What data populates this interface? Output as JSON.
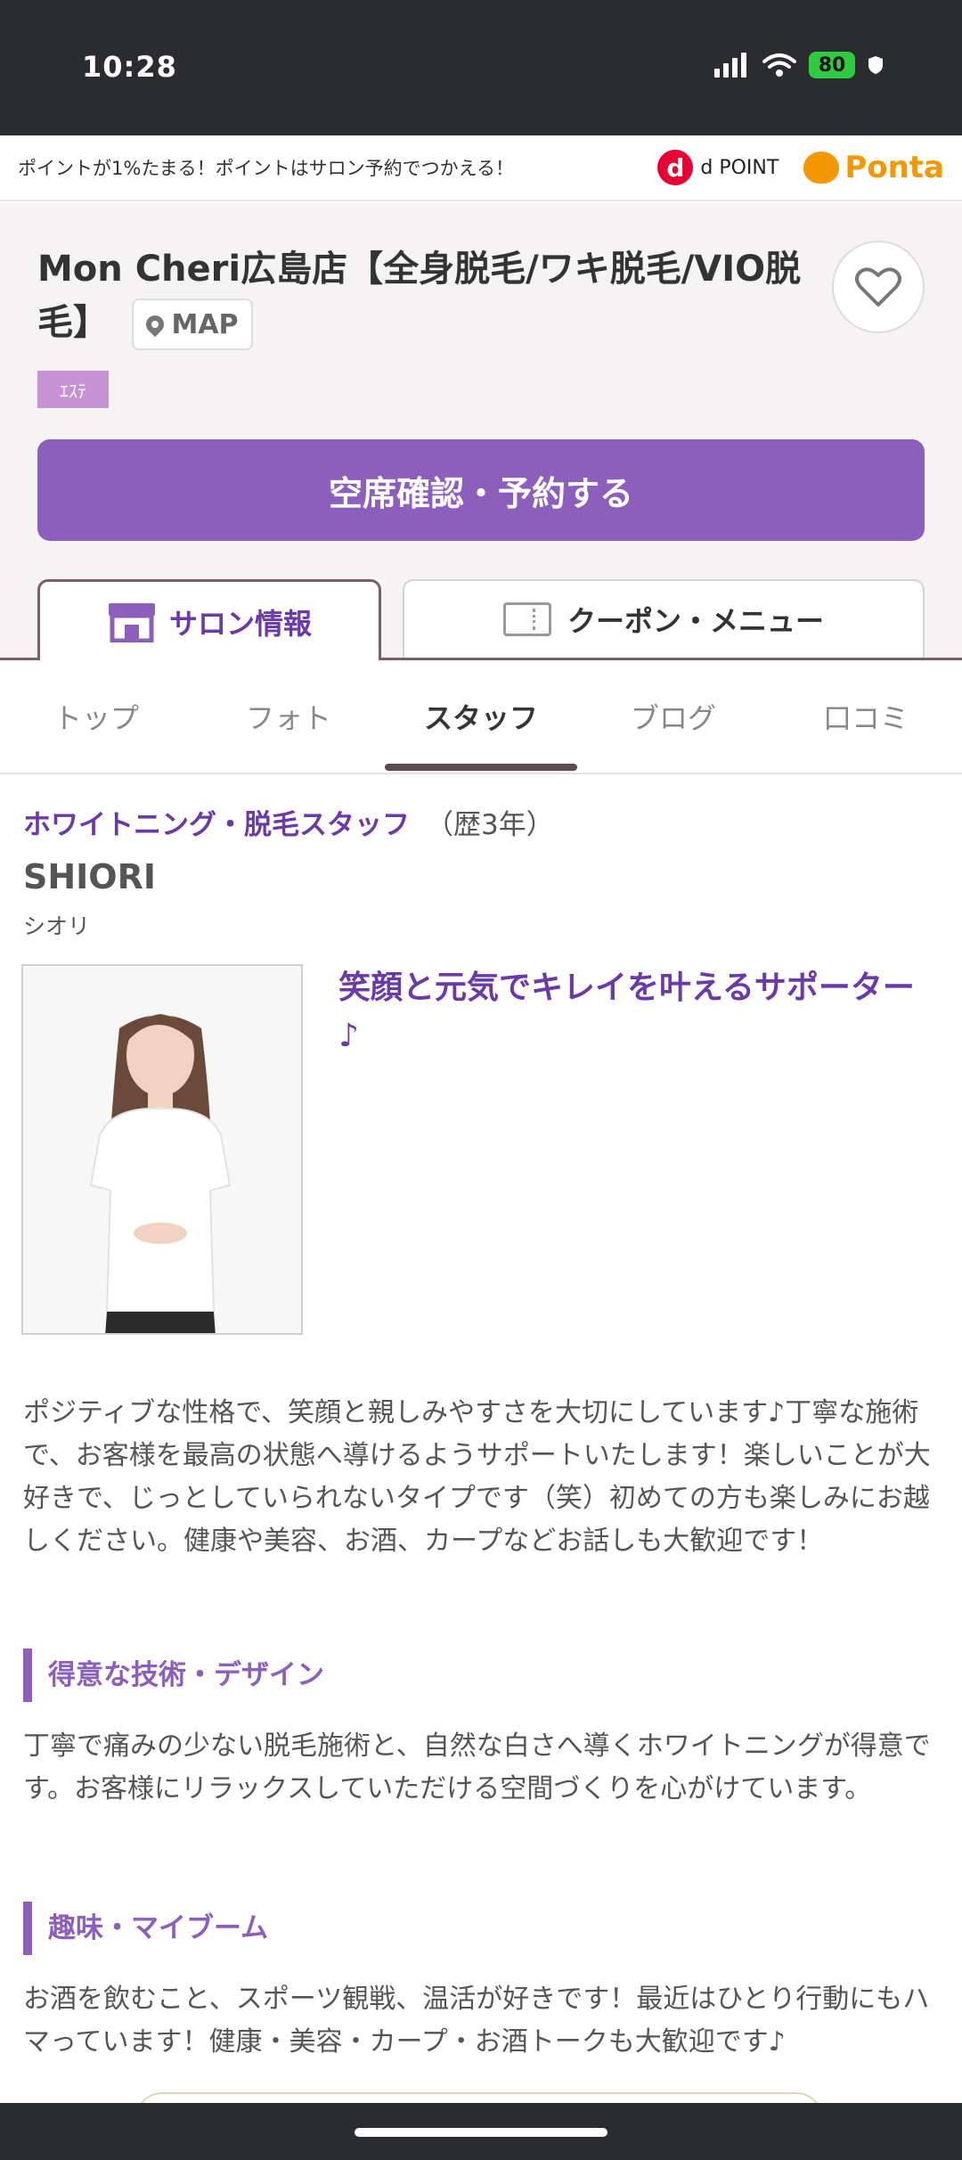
{
  "status_bar": {
    "time": "10:28",
    "battery": "80"
  },
  "points_banner": {
    "text": "ポイントが1%たまる！ポイントはサロン予約でつかえる！",
    "dpoint_mark": "d",
    "dpoint_label": "d POINT",
    "ponta_label": "Ponta"
  },
  "salon": {
    "name": "Mon Cheri広島店【全身脱毛/ワキ脱毛/VIO脱毛】",
    "map_label": "MAP",
    "category": "ｴｽﾃ",
    "reserve_label": "空席確認・予約する"
  },
  "tabs": {
    "salon_info": "サロン情報",
    "coupon_menu": "クーポン・メニュー"
  },
  "subnav": {
    "items": [
      "トップ",
      "フォト",
      "スタッフ",
      "ブログ",
      "口コミ"
    ],
    "active": "スタッフ"
  },
  "staff": {
    "role": "ホワイトニング・脱毛スタッフ",
    "years": "（歴3年）",
    "name": "SHIORI",
    "kana": "シオリ",
    "catchcopy": "笑顔と元気でキレイを叶えるサポーター♪",
    "intro": "ポジティブな性格で、笑顔と親しみやすさを大切にしています♪丁寧な施術で、お客様を最高の状態へ導けるようサポートいたします！楽しいことが大好きで、じっとしていられないタイプです（笑）初めての方も楽しみにお越しください。健康や美容、お酒、カープなどお話しも大歓迎です！",
    "skills_heading": "得意な技術・デザイン",
    "skills_body": "丁寧で痛みの少ない脱毛施術と、自然な白さへ導くホワイトニングが得意です。お客様にリラックスしていただける空間づくりを心がけています。",
    "hobby_heading": "趣味・マイブーム",
    "hobby_body": "お酒を飲むこと、スポーツ観戦、温活が好きです！最近はひとり行動にもハマっています！健康・美容・カープ・お酒トークも大歓迎です♪"
  },
  "colors": {
    "accent": "#8c5fbc",
    "accent_dark": "#6b39a8",
    "status_bg": "#2b2c30"
  }
}
